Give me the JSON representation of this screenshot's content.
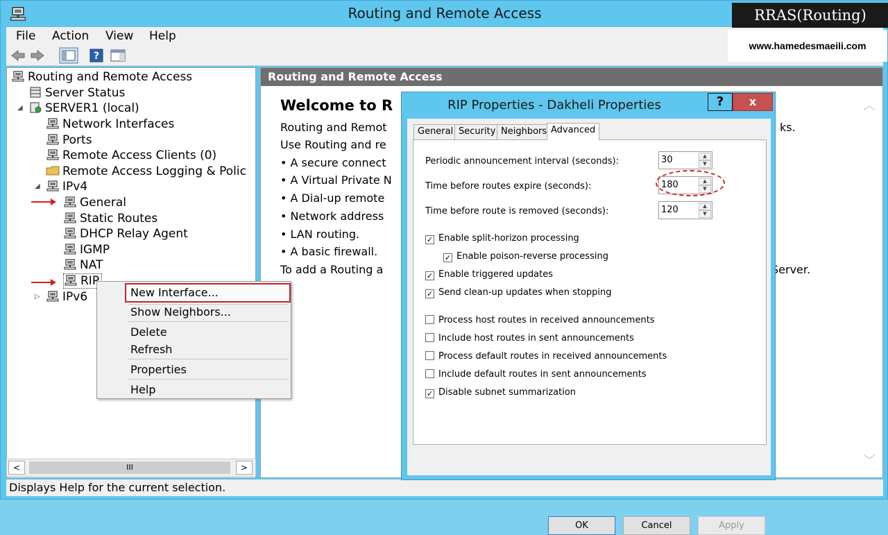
{
  "window": {
    "title": "Routing and Remote Access"
  },
  "watermark": {
    "title": "RRAS(Routing)",
    "site": "www.hamedesmaeili.com"
  },
  "menu": {
    "file": "File",
    "action": "Action",
    "view": "View",
    "help": "Help"
  },
  "toolbar": {
    "icons": [
      "back-icon",
      "forward-icon",
      "console-tree-icon",
      "help-icon",
      "action-pane-icon"
    ]
  },
  "tree": {
    "root": "Routing and Remote Access",
    "server_status": "Server Status",
    "server": "SERVER1 (local)",
    "network_interfaces": "Network Interfaces",
    "ports": "Ports",
    "remote_access_clients": "Remote Access Clients (0)",
    "remote_access_logging": "Remote Access Logging & Polic",
    "ipv4": "IPv4",
    "general": "General",
    "static_routes": "Static Routes",
    "dhcp_relay": "DHCP Relay Agent",
    "igmp": "IGMP",
    "nat": "NAT",
    "rip": "RIP",
    "ipv6": "IPv6"
  },
  "right_pane": {
    "header": "Routing and Remote Access",
    "welcome_title": "Welcome to R",
    "lines": [
      "Routing and Remot",
      "Use Routing and re",
      "• A secure connect",
      "• A Virtual Private N",
      "• A Dial-up remote",
      "• Network address",
      "• LAN routing.",
      "• A basic firewall.",
      "To add a Routing a"
    ],
    "line_end_1": "ks.",
    "line_end_2": "Server."
  },
  "context_menu": {
    "new_interface": "New Interface...",
    "show_neighbors": "Show Neighbors...",
    "delete": "Delete",
    "refresh": "Refresh",
    "properties": "Properties",
    "help": "Help"
  },
  "dialog": {
    "title": "RIP Properties - Dakheli Properties",
    "help_label": "?",
    "close_label": "x",
    "tabs": [
      "General",
      "Security",
      "Neighbors",
      "Advanced"
    ],
    "active_tab": "Advanced",
    "fields": [
      {
        "label": "Periodic announcement interval (seconds):",
        "value": "30"
      },
      {
        "label": "Time before routes expire (seconds):",
        "value": "180"
      },
      {
        "label": "Time before route is removed (seconds):",
        "value": "120"
      }
    ],
    "checkboxes": [
      {
        "label": "Enable split-horizon processing",
        "checked": true
      },
      {
        "label": "Enable poison-reverse processing",
        "checked": true
      },
      {
        "label": "Enable triggered updates",
        "checked": true
      },
      {
        "label": "Send clean-up updates when stopping",
        "checked": true
      },
      {
        "label": "Process host routes in received announcements",
        "checked": false
      },
      {
        "label": "Include host routes in sent announcements",
        "checked": false
      },
      {
        "label": "Process default routes in received announcements",
        "checked": false
      },
      {
        "label": "Include default routes in sent announcements",
        "checked": false
      },
      {
        "label": "Disable subnet summarization",
        "checked": true
      }
    ],
    "buttons": {
      "ok": "OK",
      "cancel": "Cancel",
      "apply": "Apply"
    }
  },
  "statusbar": {
    "text": "Displays Help for the current selection."
  },
  "scrollbar": {
    "grip": "III",
    "left": "<",
    "right": ">"
  },
  "colors": {
    "title_bar": "#5fc6ee",
    "header": "#6e6e6e",
    "close_button": "#c75050",
    "annotation_red": "#d42020"
  }
}
